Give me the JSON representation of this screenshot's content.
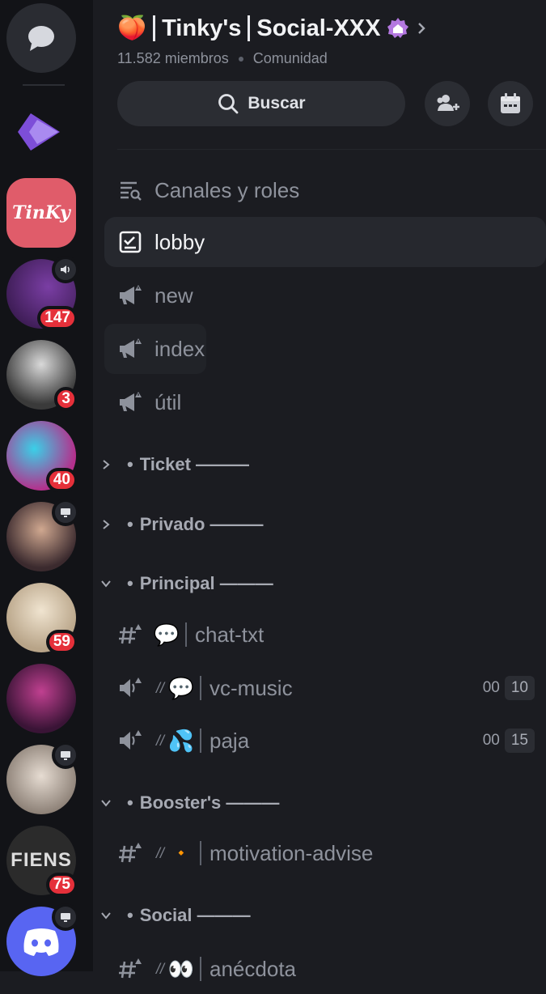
{
  "server": {
    "emoji": "🍑",
    "name": "Tinky's",
    "suffix": "Social-XXX",
    "members": "11.582 miembros",
    "type": "Comunidad"
  },
  "search": {
    "label": "Buscar"
  },
  "channels_and_roles": "Canales y roles",
  "top_channels": [
    {
      "name": "lobby"
    },
    {
      "name": "new"
    },
    {
      "name": "index"
    },
    {
      "name": "útil"
    }
  ],
  "categories": [
    {
      "name": "Ticket ———"
    },
    {
      "name": "Privado ———"
    },
    {
      "name": "Principal ———"
    },
    {
      "name": "Booster's ———"
    },
    {
      "name": "Social ———"
    }
  ],
  "principal_channels": [
    {
      "name": "chat-txt",
      "emoji": "💬"
    },
    {
      "name": "vc-music",
      "emoji": "💬",
      "prefix": "//",
      "count_a": "00",
      "count_b": "10"
    },
    {
      "name": "paja",
      "emoji": "💦",
      "prefix": "//",
      "count_a": "00",
      "count_b": "15"
    }
  ],
  "booster_channels": [
    {
      "name": "motivation-advise",
      "emoji": "🔸",
      "prefix": "//"
    }
  ],
  "social_channels": [
    {
      "name": "anécdota",
      "emoji": "👀",
      "prefix": "//"
    }
  ],
  "rail": {
    "tinky_label": "TinKy",
    "fiens_label": "FIENS",
    "badges": [
      "147",
      "3",
      "40",
      "59",
      "75"
    ]
  },
  "colors": {
    "badge": "#e5303a",
    "accent": "#5865f2",
    "boost": "#b478e0"
  }
}
